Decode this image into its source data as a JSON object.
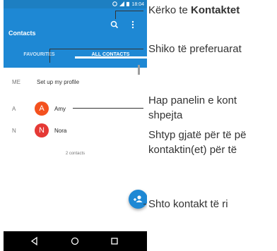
{
  "status_bar": {
    "time": "18:04"
  },
  "app_bar": {
    "title": "Contacts",
    "tabs": [
      {
        "label": "FAVOURITES",
        "selected": false
      },
      {
        "label": "ALL CONTACTS",
        "selected": true
      }
    ]
  },
  "profile": {
    "section": "ME",
    "text": "Set up my profile"
  },
  "contacts": [
    {
      "section": "A",
      "initial": "A",
      "name": "Amy",
      "color": "#f4511e"
    },
    {
      "section": "N",
      "initial": "N",
      "name": "Nora",
      "color": "#e53935"
    }
  ],
  "contacts_count": "2 contacts",
  "annotations": {
    "find_prefix": "Kërko te ",
    "find_bold": "Kontaktet",
    "favourites": "Shiko të preferuarat",
    "panel_line1": "Hap panelin e kont",
    "panel_line2": "shpejta",
    "hold_line1": "Shtyp gjatë për të pë",
    "hold_line2": "kontaktin(et) për të",
    "add": "Shto kontakt të ri"
  },
  "colors": {
    "accent": "#1e88d4",
    "status_bar": "#1d7fc2"
  }
}
